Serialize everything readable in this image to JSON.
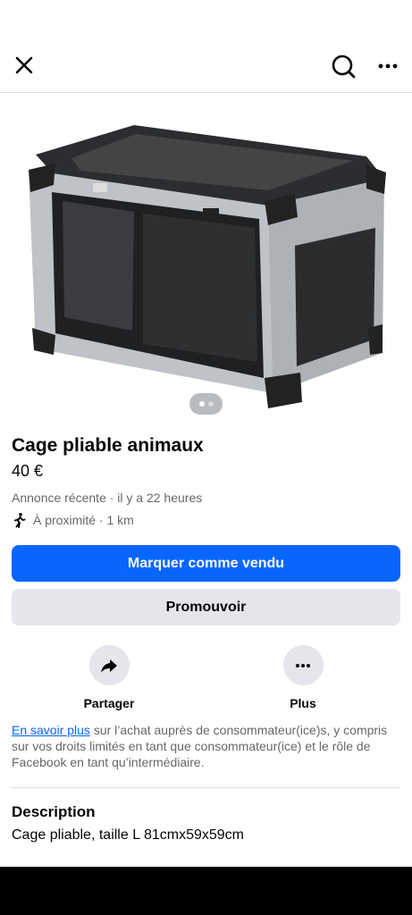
{
  "header": {
    "close_icon": "close-icon",
    "search_icon": "search-icon",
    "more_icon": "more-horizontal-icon"
  },
  "listing": {
    "image_pages": 2,
    "image_current": 1,
    "title": "Cage pliable animaux",
    "price": "40 €",
    "meta": "Annonce récente · il y a 22 heures",
    "nearby": "À proximité · 1 km"
  },
  "buttons": {
    "mark_sold": "Marquer comme vendu",
    "promote": "Promouvoir"
  },
  "actions": {
    "share": "Partager",
    "more": "Plus"
  },
  "info": {
    "link": "En savoir plus",
    "text": " sur l’achat auprès de consommateur(ice)s, y compris sur vos droits limités en tant que consommateur(ice) et le rôle de Facebook en tant qu’intermédiaire."
  },
  "description": {
    "heading": "Description",
    "text": "Cage pliable, taille L 81cmx59x59cm"
  },
  "colors": {
    "primary": "#0866ff",
    "secondary_bg": "#e4e6eb",
    "muted_text": "#65676b"
  }
}
